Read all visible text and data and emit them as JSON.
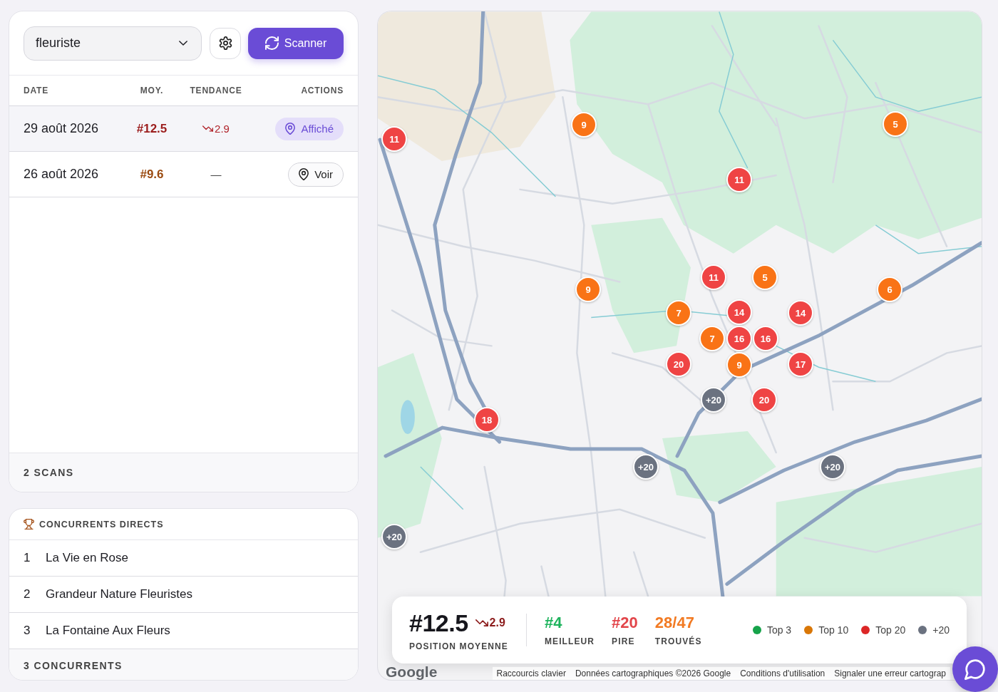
{
  "keyword_select": {
    "value": "fleuriste"
  },
  "scan_button": {
    "label": "Scanner"
  },
  "history": {
    "columns": [
      "DATE",
      "MOY.",
      "TENDANCE",
      "ACTIONS"
    ],
    "rows": [
      {
        "date": "29 août 2026",
        "average": "#12.5",
        "color": "#9b1c1c",
        "trend": {
          "falling": true,
          "value": "2.9"
        },
        "action": "Affiché",
        "selected": true
      },
      {
        "date": "26 août 2026",
        "average": "#9.6",
        "color": "#9a4a10",
        "trend": {
          "falling": false,
          "value": "—"
        },
        "action": "Voir",
        "selected": false
      }
    ],
    "footer": "2 SCANS"
  },
  "competitors": {
    "title": "CONCURRENTS DIRECTS",
    "items": [
      {
        "rank": "1",
        "name": "La Vie en Rose"
      },
      {
        "rank": "2",
        "name": "Grandeur Nature Fleuristes"
      },
      {
        "rank": "3",
        "name": "La Fontaine Aux Fleurs"
      }
    ],
    "footer": "3 CONCURRENTS"
  },
  "map": {
    "markers": [
      {
        "label": "11",
        "color": "#ef4444"
      },
      {
        "label": "9",
        "color": "#f97316"
      },
      {
        "label": "5",
        "color": "#f97316"
      },
      {
        "label": "11",
        "color": "#ef4444"
      },
      {
        "label": "11",
        "color": "#ef4444"
      },
      {
        "label": "5",
        "color": "#f97316"
      },
      {
        "label": "9",
        "color": "#f97316"
      },
      {
        "label": "6",
        "color": "#f97316"
      },
      {
        "label": "7",
        "color": "#f97316"
      },
      {
        "label": "14",
        "color": "#ef4444"
      },
      {
        "label": "14",
        "color": "#ef4444"
      },
      {
        "label": "7",
        "color": "#f97316"
      },
      {
        "label": "16",
        "color": "#ef4444"
      },
      {
        "label": "16",
        "color": "#ef4444"
      },
      {
        "label": "20",
        "color": "#ef4444"
      },
      {
        "label": "9",
        "color": "#f97316"
      },
      {
        "label": "17",
        "color": "#ef4444"
      },
      {
        "label": "+20",
        "color": "#6b7280"
      },
      {
        "label": "20",
        "color": "#ef4444"
      },
      {
        "label": "18",
        "color": "#ef4444"
      },
      {
        "label": "+20",
        "color": "#6b7280"
      },
      {
        "label": "+20",
        "color": "#6b7280"
      },
      {
        "label": "+20",
        "color": "#6b7280"
      }
    ],
    "summary": {
      "average": "#12.5",
      "trend": {
        "falling": true,
        "value": "2.9"
      },
      "average_label": "POSITION MOYENNE",
      "stats": [
        {
          "kind": "best",
          "value": "#4",
          "label": "MEILLEUR"
        },
        {
          "kind": "worst",
          "value": "#20",
          "label": "PIRE"
        },
        {
          "kind": "found",
          "value": "28/47",
          "label": "TROUVÉS"
        }
      ],
      "legend": [
        {
          "label": "Top 3",
          "color": "#16a34a"
        },
        {
          "label": "Top 10",
          "color": "#d97706"
        },
        {
          "label": "Top 20",
          "color": "#dc2626"
        },
        {
          "label": "+20",
          "color": "#6b7280"
        }
      ]
    },
    "logo": "Google",
    "attribution": [
      "Raccourcis clavier",
      "Données cartographiques ©2026 Google",
      "Conditions d'utilisation",
      "Signaler une erreur cartograp"
    ]
  }
}
